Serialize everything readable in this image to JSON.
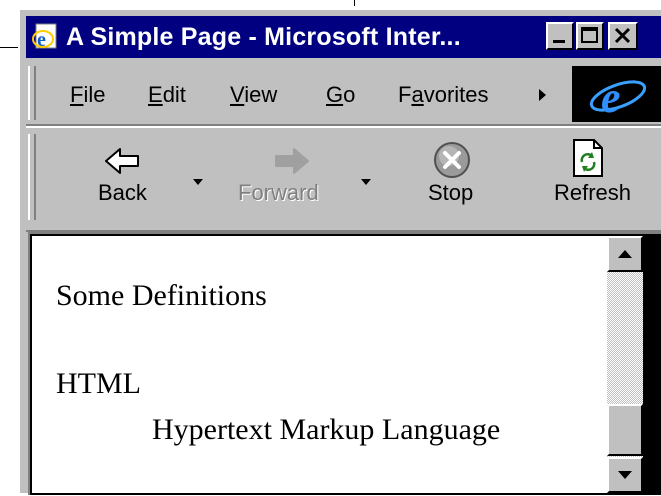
{
  "window": {
    "title": "A Simple Page - Microsoft Inter..."
  },
  "menu": {
    "items": [
      {
        "label": "File",
        "accel": "F",
        "rest": "ile"
      },
      {
        "label": "Edit",
        "accel": "E",
        "rest": "dit"
      },
      {
        "label": "View",
        "accel": "V",
        "rest": "iew"
      },
      {
        "label": "Go",
        "accel": "G",
        "rest": "o"
      },
      {
        "pre": "F",
        "accel": "a",
        "rest": "vorites",
        "label": "Favorites"
      }
    ]
  },
  "toolbar": {
    "back_label": "Back",
    "forward_label": "Forward",
    "stop_label": "Stop",
    "refresh_label": "Refresh"
  },
  "page": {
    "heading": "Some Definitions",
    "term": "HTML",
    "definition": "Hypertext Markup Language"
  },
  "colors": {
    "titlebar": "#000080",
    "chrome": "#c0c0c0",
    "forward_disabled": "#808080"
  },
  "icons": [
    "ie-page-icon",
    "minimize-icon",
    "maximize-icon",
    "close-icon",
    "menu-more-icon",
    "ie-logo-icon",
    "back-arrow-icon",
    "forward-arrow-icon",
    "stop-icon",
    "refresh-icon",
    "scroll-up-icon",
    "scroll-down-icon"
  ]
}
